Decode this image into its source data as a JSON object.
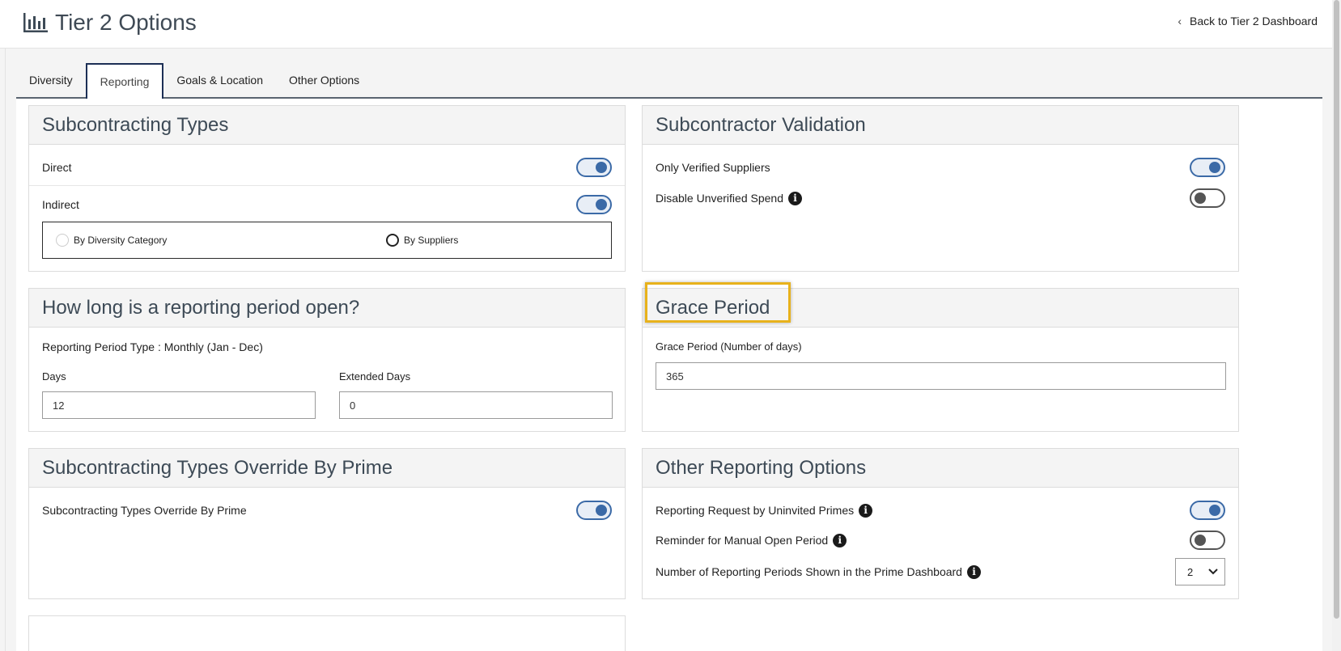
{
  "header": {
    "title": "Tier 2 Options",
    "back_link": "Back to Tier 2 Dashboard"
  },
  "tabs": [
    {
      "label": "Diversity",
      "active": false
    },
    {
      "label": "Reporting",
      "active": true
    },
    {
      "label": "Goals & Location",
      "active": false
    },
    {
      "label": "Other Options",
      "active": false
    }
  ],
  "subcontracting_types": {
    "title": "Subcontracting Types",
    "direct": {
      "label": "Direct",
      "enabled": true
    },
    "indirect": {
      "label": "Indirect",
      "enabled": true
    },
    "options": [
      {
        "label": "By Diversity Category",
        "selected": false
      },
      {
        "label": "By Suppliers",
        "selected": false
      }
    ]
  },
  "subcontractor_validation": {
    "title": "Subcontractor Validation",
    "only_verified": {
      "label": "Only Verified Suppliers",
      "enabled": true
    },
    "disable_unverified": {
      "label": "Disable Unverified Spend",
      "enabled": false
    }
  },
  "reporting_period": {
    "title": "How long is a reporting period open?",
    "type_text": "Reporting Period Type : Monthly (Jan - Dec)",
    "days_label": "Days",
    "days_value": "12",
    "extended_label": "Extended Days",
    "extended_value": "0"
  },
  "grace_period": {
    "title": "Grace Period",
    "field_label": "Grace Period (Number of days)",
    "value": "365"
  },
  "override_by_prime": {
    "title": "Subcontracting Types Override By Prime",
    "toggle_label": "Subcontracting Types Override By Prime",
    "enabled": true
  },
  "other_reporting": {
    "title": "Other Reporting Options",
    "uninvited_primes": {
      "label": "Reporting Request by Uninvited Primes",
      "enabled": true
    },
    "manual_reminder": {
      "label": "Reminder for Manual Open Period",
      "enabled": false
    },
    "periods_shown": {
      "label": "Number of Reporting Periods Shown in the Prime Dashboard",
      "value": "2"
    }
  },
  "colors": {
    "accent": "#3b6aa7",
    "highlight": "#e8b21c",
    "tab_border": "#1c2f55"
  }
}
